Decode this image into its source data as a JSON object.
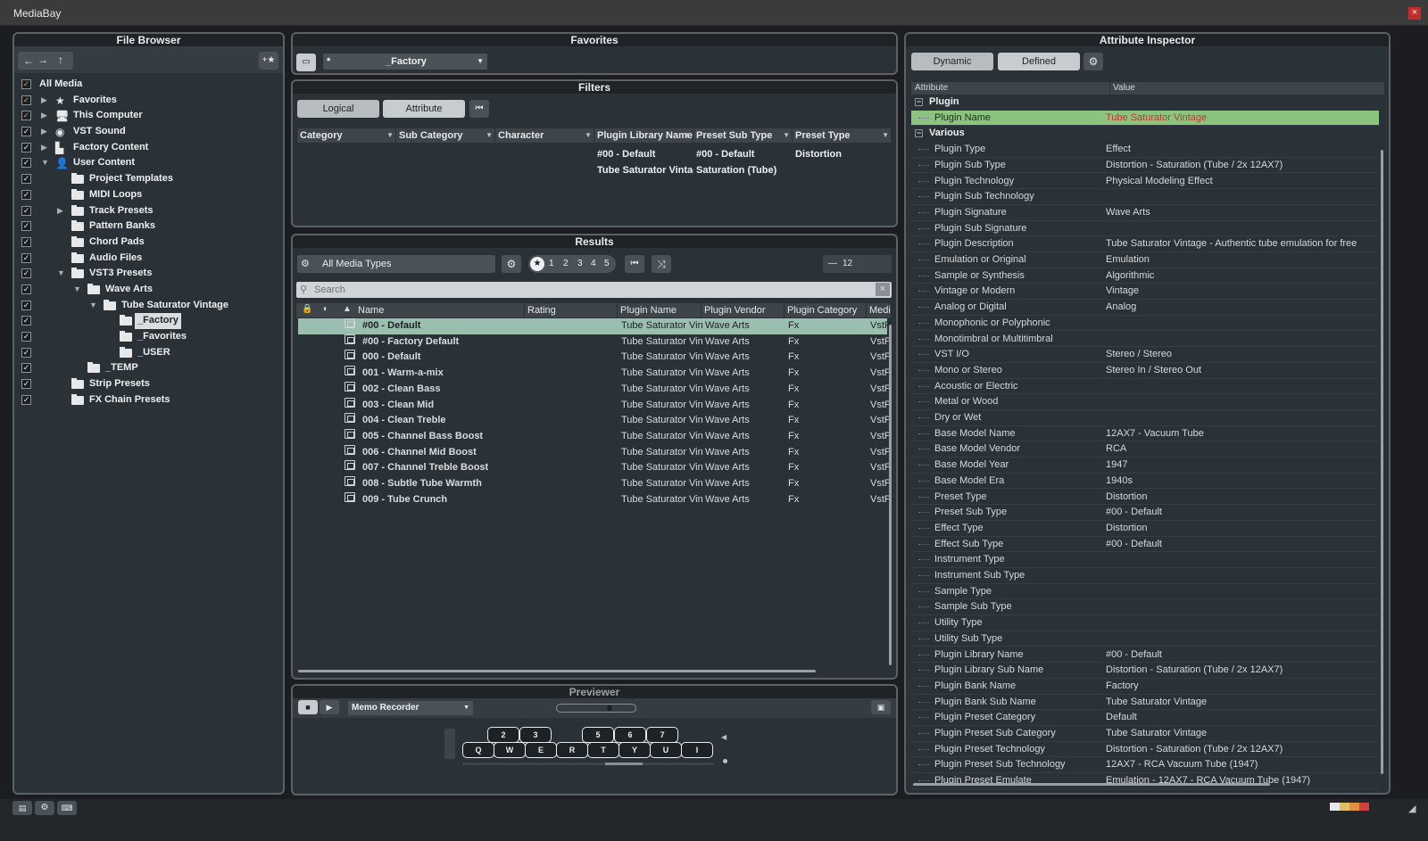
{
  "window": {
    "title": "MediaBay",
    "close": "×"
  },
  "file_browser": {
    "title": "File Browser",
    "nav_back": "←",
    "nav_forward": "→",
    "nav_up": "↑",
    "add_favorite": "+★",
    "items": [
      {
        "label": "All Media",
        "check": "✓",
        "part": true
      },
      {
        "label": "Favorites",
        "check": "✓",
        "part": true
      },
      {
        "label": "This Computer",
        "check": "✓",
        "part": true
      },
      {
        "label": "VST Sound",
        "check": "✓"
      },
      {
        "label": "Factory Content",
        "check": "✓"
      },
      {
        "label": "User Content",
        "check": "✓"
      },
      {
        "label": "Project Templates",
        "check": "✓"
      },
      {
        "label": "MIDI Loops",
        "check": "✓"
      },
      {
        "label": "Track Presets",
        "check": "✓"
      },
      {
        "label": "Pattern Banks",
        "check": "✓"
      },
      {
        "label": "Chord Pads",
        "check": "✓"
      },
      {
        "label": "Audio Files",
        "check": "✓"
      },
      {
        "label": "VST3 Presets",
        "check": "✓"
      },
      {
        "label": "Wave Arts",
        "check": "✓"
      },
      {
        "label": "Tube Saturator Vintage",
        "check": "✓"
      },
      {
        "label": "_Factory",
        "check": "✓"
      },
      {
        "label": "_Favorites",
        "check": "✓"
      },
      {
        "label": "_USER",
        "check": "✓"
      },
      {
        "label": "_TEMP",
        "check": "✓"
      },
      {
        "label": "Strip Presets",
        "check": "✓"
      },
      {
        "label": "FX Chain Presets",
        "check": "✓"
      }
    ]
  },
  "favorites": {
    "title": "Favorites",
    "selector_prefix": "*",
    "selector_value": "_Factory"
  },
  "filters": {
    "title": "Filters",
    "tab_logical": "Logical",
    "tab_attribute": "Attribute",
    "reset": "⏮",
    "columns": [
      "Category",
      "Sub Category",
      "Character",
      "Plugin Library Name",
      "Preset Sub Type",
      "Preset Type"
    ],
    "values": {
      "plugin_library_name": [
        "#00 - Default",
        "Tube Saturator Vintag"
      ],
      "preset_sub_type": [
        "#00 - Default",
        "Saturation (Tube)"
      ],
      "preset_type": [
        "Distortion"
      ]
    }
  },
  "results": {
    "title": "Results",
    "media_type": "All Media Types",
    "rating_filter": [
      "★",
      "1",
      "2",
      "3",
      "4",
      "5"
    ],
    "count": "12",
    "count_prefix": "—",
    "search_placeholder": "Search",
    "columns": [
      "Name",
      "Rating",
      "Plugin Name",
      "Plugin Vendor",
      "Plugin Category",
      "Media"
    ],
    "rows": [
      {
        "name": "#00 - Default",
        "plugin": "Tube Saturator Vint",
        "vendor": "Wave Arts",
        "category": "Fx",
        "media": "VstP"
      },
      {
        "name": "#00 - Factory Default",
        "plugin": "Tube Saturator Vint",
        "vendor": "Wave Arts",
        "category": "Fx",
        "media": "VstP"
      },
      {
        "name": "000 - Default",
        "plugin": "Tube Saturator Vint",
        "vendor": "Wave Arts",
        "category": "Fx",
        "media": "VstP"
      },
      {
        "name": "001 - Warm-a-mix",
        "plugin": "Tube Saturator Vint",
        "vendor": "Wave Arts",
        "category": "Fx",
        "media": "VstP"
      },
      {
        "name": "002 - Clean Bass",
        "plugin": "Tube Saturator Vint",
        "vendor": "Wave Arts",
        "category": "Fx",
        "media": "VstP"
      },
      {
        "name": "003 - Clean Mid",
        "plugin": "Tube Saturator Vint",
        "vendor": "Wave Arts",
        "category": "Fx",
        "media": "VstP"
      },
      {
        "name": "004 - Clean Treble",
        "plugin": "Tube Saturator Vint",
        "vendor": "Wave Arts",
        "category": "Fx",
        "media": "VstP"
      },
      {
        "name": "005 - Channel Bass Boost",
        "plugin": "Tube Saturator Vint",
        "vendor": "Wave Arts",
        "category": "Fx",
        "media": "VstP"
      },
      {
        "name": "006 - Channel Mid Boost",
        "plugin": "Tube Saturator Vint",
        "vendor": "Wave Arts",
        "category": "Fx",
        "media": "VstP"
      },
      {
        "name": "007 - Channel Treble Boost",
        "plugin": "Tube Saturator Vint",
        "vendor": "Wave Arts",
        "category": "Fx",
        "media": "VstP"
      },
      {
        "name": "008 - Subtle Tube Warmth",
        "plugin": "Tube Saturator Vint",
        "vendor": "Wave Arts",
        "category": "Fx",
        "media": "VstP"
      },
      {
        "name": "009 - Tube Crunch",
        "plugin": "Tube Saturator Vint",
        "vendor": "Wave Arts",
        "category": "Fx",
        "media": "VstP"
      }
    ]
  },
  "previewer": {
    "title": "Previewer",
    "recorder": "Memo Recorder",
    "keys_top": [
      "2",
      "3",
      "5",
      "6",
      "7"
    ],
    "keys_bottom": [
      "Q",
      "W",
      "E",
      "R",
      "T",
      "Y",
      "U",
      "I"
    ]
  },
  "inspector": {
    "title": "Attribute Inspector",
    "tab_dynamic": "Dynamic",
    "tab_defined": "Defined",
    "col_attribute": "Attribute",
    "col_value": "Value",
    "group_plugin": "Plugin",
    "group_various": "Various",
    "plugin_name": {
      "k": "Plugin Name",
      "v": "Tube Saturator Vintage"
    },
    "rows": [
      {
        "k": "Plugin Type",
        "v": "Effect"
      },
      {
        "k": "Plugin Sub Type",
        "v": "Distortion - Saturation (Tube / 2x 12AX7)"
      },
      {
        "k": "Plugin Technology",
        "v": "Physical Modeling Effect"
      },
      {
        "k": "Plugin Sub Technology",
        "v": ""
      },
      {
        "k": "Plugin Signature",
        "v": "Wave Arts"
      },
      {
        "k": "Plugin Sub Signature",
        "v": ""
      },
      {
        "k": "Plugin Description",
        "v": "Tube Saturator Vintage - Authentic tube emulation for free"
      },
      {
        "k": "Emulation or Original",
        "v": "Emulation"
      },
      {
        "k": "Sample or Synthesis",
        "v": "Algorithmic"
      },
      {
        "k": "Vintage or Modern",
        "v": "Vintage"
      },
      {
        "k": "Analog or Digital",
        "v": "Analog"
      },
      {
        "k": "Monophonic or Polyphonic",
        "v": ""
      },
      {
        "k": "Monotimbral or Multitimbral",
        "v": ""
      },
      {
        "k": "VST I/O",
        "v": "Stereo / Stereo"
      },
      {
        "k": "Mono or Stereo",
        "v": "Stereo In / Stereo Out"
      },
      {
        "k": "Acoustic or Electric",
        "v": ""
      },
      {
        "k": "Metal or Wood",
        "v": ""
      },
      {
        "k": "Dry or Wet",
        "v": ""
      },
      {
        "k": "Base Model Name",
        "v": "12AX7 - Vacuum Tube"
      },
      {
        "k": "Base Model Vendor",
        "v": "RCA"
      },
      {
        "k": "Base Model Year",
        "v": "1947"
      },
      {
        "k": "Base Model Era",
        "v": "1940s"
      },
      {
        "k": "Preset Type",
        "v": "Distortion"
      },
      {
        "k": "Preset Sub Type",
        "v": "#00 - Default"
      },
      {
        "k": "Effect Type",
        "v": "Distortion"
      },
      {
        "k": "Effect Sub Type",
        "v": "#00 - Default"
      },
      {
        "k": "Instrument Type",
        "v": ""
      },
      {
        "k": "Instrument Sub Type",
        "v": ""
      },
      {
        "k": "Sample Type",
        "v": ""
      },
      {
        "k": "Sample Sub Type",
        "v": ""
      },
      {
        "k": "Utility Type",
        "v": ""
      },
      {
        "k": "Utility Sub Type",
        "v": ""
      },
      {
        "k": "Plugin Library Name",
        "v": "#00 - Default"
      },
      {
        "k": "Plugin Library Sub Name",
        "v": "Distortion - Saturation (Tube / 2x 12AX7)"
      },
      {
        "k": "Plugin Bank Name",
        "v": "Factory"
      },
      {
        "k": "Plugin Bank Sub Name",
        "v": "Tube Saturator Vintage"
      },
      {
        "k": "Plugin Preset Category",
        "v": "Default"
      },
      {
        "k": "Plugin Preset Sub Category",
        "v": "Tube Saturator Vintage"
      },
      {
        "k": "Plugin Preset Technology",
        "v": "Distortion - Saturation (Tube / 2x 12AX7)"
      },
      {
        "k": "Plugin Preset Sub Technology",
        "v": "12AX7 - RCA Vacuum Tube (1947)"
      },
      {
        "k": "Plugin Preset Emulate",
        "v": "Emulation - 12AX7 - RCA Vacuum Tube (1947)"
      }
    ]
  },
  "colors": {
    "selection": "#9bbfae",
    "inspector_selection": "#8bc47f",
    "value_highlight": "#c0392b"
  }
}
